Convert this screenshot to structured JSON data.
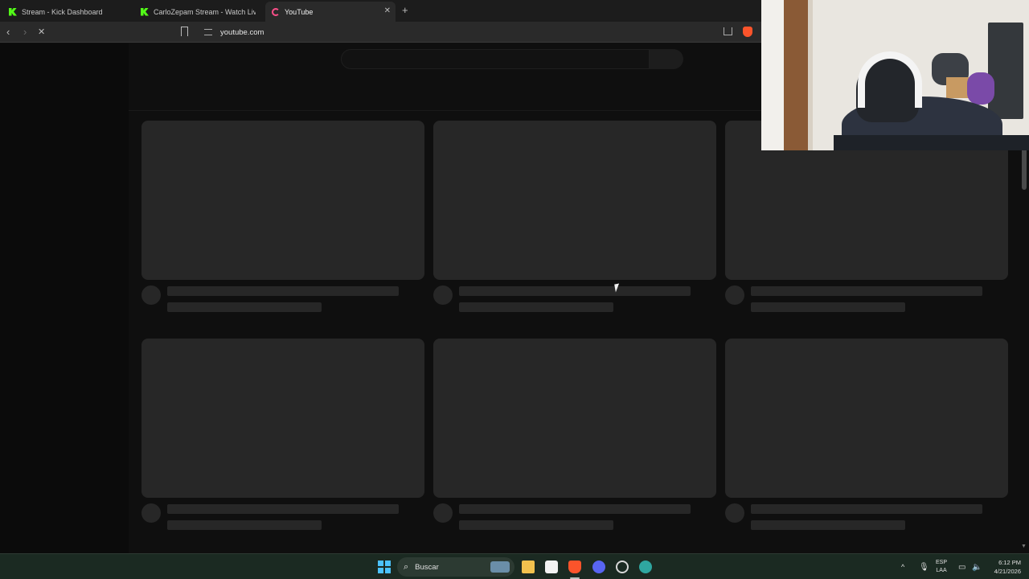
{
  "tabs": [
    {
      "label": "Stream - Kick Dashboard",
      "icon": "kick-icon"
    },
    {
      "label": "CarloZepam Stream - Watch Live on",
      "icon": "kick-icon"
    },
    {
      "label": "YouTube",
      "icon": "youtube-loading-icon",
      "active": true
    }
  ],
  "toolbar": {
    "url": "youtube.com"
  },
  "taskbar": {
    "search_label": "Buscar",
    "lang_line1": "ESP",
    "lang_line2": "LAA",
    "time": "6:12 PM",
    "date": "4/21/2026"
  },
  "colors": {
    "page_bg": "#0f0f0f",
    "skeleton": "#272727",
    "kick_green": "#53fc18",
    "brave_orange": "#fb542b",
    "taskbar_bg": "#1b2a22"
  }
}
